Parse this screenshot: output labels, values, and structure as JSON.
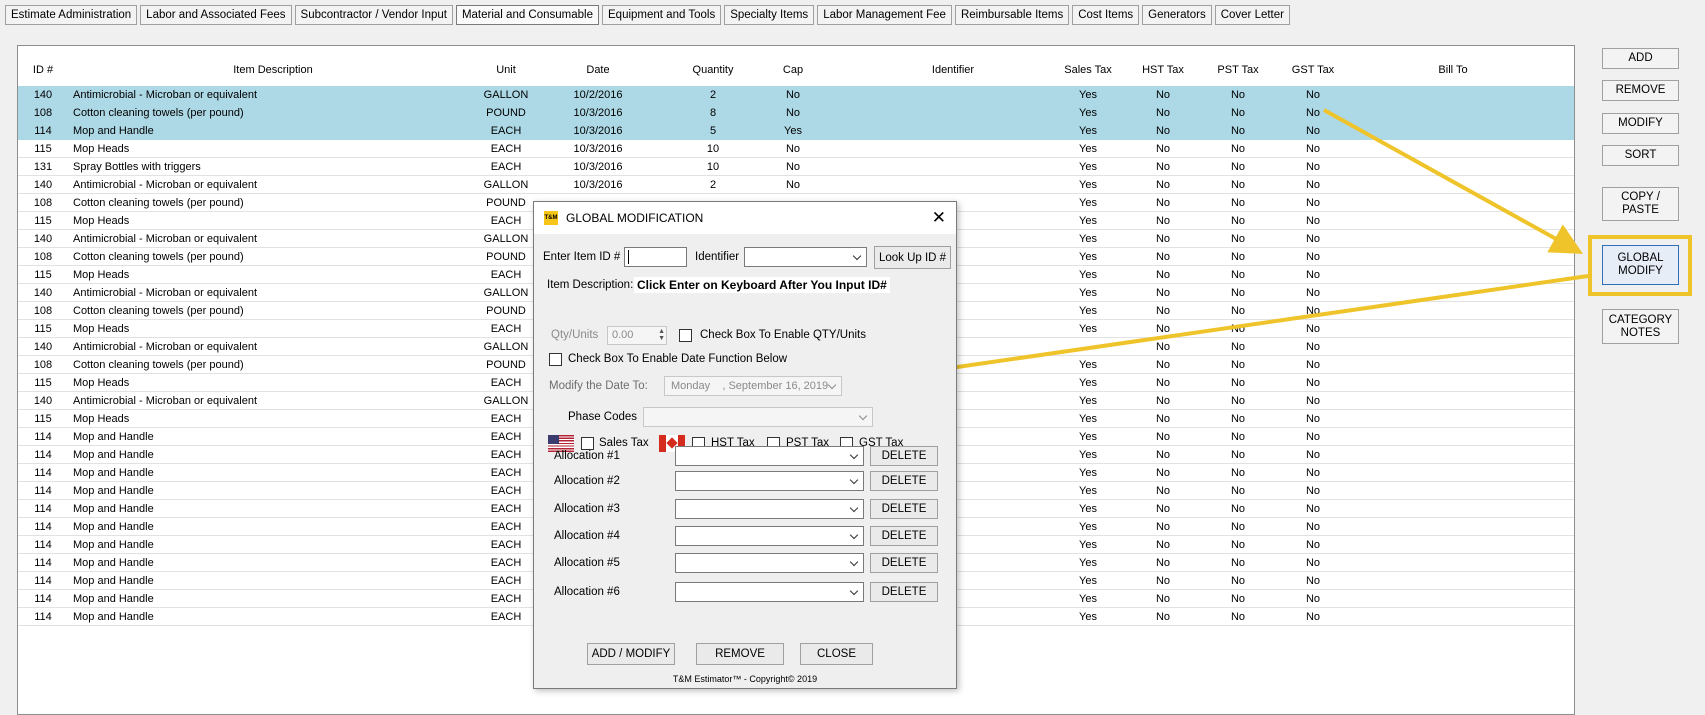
{
  "tabs": [
    "Estimate Administration",
    "Labor and Associated Fees",
    "Subcontractor / Vendor Input",
    "Material and Consumable",
    "Equipment and Tools",
    "Specialty Items",
    "Labor Management Fee",
    "Reimbursable Items",
    "Cost Items",
    "Generators",
    "Cover Letter"
  ],
  "active_tab_index": 3,
  "grid": {
    "headers": [
      "ID #",
      "Item Description",
      "Unit",
      "Date",
      "Quantity",
      "Cap",
      "Identifier",
      "Sales Tax",
      "HST Tax",
      "PST Tax",
      "GST Tax",
      "Bill To"
    ],
    "rows": [
      {
        "id": "140",
        "desc": "Antimicrobial - Microban or equivalent",
        "unit": "GALLON",
        "date": "10/2/2016",
        "qty": "2",
        "cap": "No",
        "ident": "",
        "sales": "Yes",
        "hst": "No",
        "pst": "No",
        "gst": "No",
        "bill": "",
        "selected": true
      },
      {
        "id": "108",
        "desc": "Cotton cleaning towels (per pound)",
        "unit": "POUND",
        "date": "10/3/2016",
        "qty": "8",
        "cap": "No",
        "ident": "",
        "sales": "Yes",
        "hst": "No",
        "pst": "No",
        "gst": "No",
        "bill": "",
        "selected": true
      },
      {
        "id": "114",
        "desc": "Mop  and Handle",
        "unit": "EACH",
        "date": "10/3/2016",
        "qty": "5",
        "cap": "Yes",
        "ident": "",
        "sales": "Yes",
        "hst": "No",
        "pst": "No",
        "gst": "No",
        "bill": "",
        "selected": true
      },
      {
        "id": "115",
        "desc": "Mop Heads",
        "unit": "EACH",
        "date": "10/3/2016",
        "qty": "10",
        "cap": "No",
        "ident": "",
        "sales": "Yes",
        "hst": "No",
        "pst": "No",
        "gst": "No",
        "bill": ""
      },
      {
        "id": "131",
        "desc": "Spray Bottles with triggers",
        "unit": "EACH",
        "date": "10/3/2016",
        "qty": "10",
        "cap": "No",
        "ident": "",
        "sales": "Yes",
        "hst": "No",
        "pst": "No",
        "gst": "No",
        "bill": ""
      },
      {
        "id": "140",
        "desc": "Antimicrobial - Microban or equivalent",
        "unit": "GALLON",
        "date": "10/3/2016",
        "qty": "2",
        "cap": "No",
        "ident": "",
        "sales": "Yes",
        "hst": "No",
        "pst": "No",
        "gst": "No",
        "bill": ""
      },
      {
        "id": "108",
        "desc": "Cotton cleaning towels (per pound)",
        "unit": "POUND",
        "date": "",
        "qty": "",
        "cap": "",
        "ident": "",
        "sales": "Yes",
        "hst": "No",
        "pst": "No",
        "gst": "No",
        "bill": ""
      },
      {
        "id": "115",
        "desc": "Mop Heads",
        "unit": "EACH",
        "date": "",
        "qty": "",
        "cap": "",
        "ident": "",
        "sales": "Yes",
        "hst": "No",
        "pst": "No",
        "gst": "No",
        "bill": ""
      },
      {
        "id": "140",
        "desc": "Antimicrobial - Microban or equivalent",
        "unit": "GALLON",
        "date": "",
        "qty": "",
        "cap": "",
        "ident": "",
        "sales": "Yes",
        "hst": "No",
        "pst": "No",
        "gst": "No",
        "bill": ""
      },
      {
        "id": "108",
        "desc": "Cotton cleaning towels (per pound)",
        "unit": "POUND",
        "date": "",
        "qty": "",
        "cap": "",
        "ident": "",
        "sales": "Yes",
        "hst": "No",
        "pst": "No",
        "gst": "No",
        "bill": ""
      },
      {
        "id": "115",
        "desc": "Mop Heads",
        "unit": "EACH",
        "date": "",
        "qty": "",
        "cap": "",
        "ident": "",
        "sales": "Yes",
        "hst": "No",
        "pst": "No",
        "gst": "No",
        "bill": ""
      },
      {
        "id": "140",
        "desc": "Antimicrobial - Microban or equivalent",
        "unit": "GALLON",
        "date": "",
        "qty": "",
        "cap": "",
        "ident": "",
        "sales": "Yes",
        "hst": "No",
        "pst": "No",
        "gst": "No",
        "bill": ""
      },
      {
        "id": "108",
        "desc": "Cotton cleaning towels (per pound)",
        "unit": "POUND",
        "date": "",
        "qty": "",
        "cap": "",
        "ident": "",
        "sales": "Yes",
        "hst": "No",
        "pst": "No",
        "gst": "No",
        "bill": ""
      },
      {
        "id": "115",
        "desc": "Mop Heads",
        "unit": "EACH",
        "date": "",
        "qty": "",
        "cap": "",
        "ident": "",
        "sales": "Yes",
        "hst": "No",
        "pst": "No",
        "gst": "No",
        "bill": ""
      },
      {
        "id": "140",
        "desc": "Antimicrobial - Microban or equivalent",
        "unit": "GALLON",
        "date": "",
        "qty": "",
        "cap": "",
        "ident": "",
        "sales": "",
        "hst": "No",
        "pst": "No",
        "gst": "No",
        "bill": ""
      },
      {
        "id": "108",
        "desc": "Cotton cleaning towels (per pound)",
        "unit": "POUND",
        "date": "",
        "qty": "",
        "cap": "",
        "ident": "",
        "sales": "Yes",
        "hst": "No",
        "pst": "No",
        "gst": "No",
        "bill": ""
      },
      {
        "id": "115",
        "desc": "Mop Heads",
        "unit": "EACH",
        "date": "",
        "qty": "",
        "cap": "",
        "ident": "",
        "sales": "Yes",
        "hst": "No",
        "pst": "No",
        "gst": "No",
        "bill": ""
      },
      {
        "id": "140",
        "desc": "Antimicrobial - Microban or equivalent",
        "unit": "GALLON",
        "date": "",
        "qty": "",
        "cap": "",
        "ident": "",
        "sales": "Yes",
        "hst": "No",
        "pst": "No",
        "gst": "No",
        "bill": ""
      },
      {
        "id": "115",
        "desc": "Mop Heads",
        "unit": "EACH",
        "date": "",
        "qty": "",
        "cap": "",
        "ident": "",
        "sales": "Yes",
        "hst": "No",
        "pst": "No",
        "gst": "No",
        "bill": ""
      },
      {
        "id": "114",
        "desc": "Mop  and Handle",
        "unit": "EACH",
        "date": "",
        "qty": "",
        "cap": "",
        "ident": "",
        "sales": "Yes",
        "hst": "No",
        "pst": "No",
        "gst": "No",
        "bill": ""
      },
      {
        "id": "114",
        "desc": "Mop  and Handle",
        "unit": "EACH",
        "date": "",
        "qty": "",
        "cap": "",
        "ident": "",
        "sales": "Yes",
        "hst": "No",
        "pst": "No",
        "gst": "No",
        "bill": ""
      },
      {
        "id": "114",
        "desc": "Mop  and Handle",
        "unit": "EACH",
        "date": "",
        "qty": "",
        "cap": "",
        "ident": "",
        "sales": "Yes",
        "hst": "No",
        "pst": "No",
        "gst": "No",
        "bill": ""
      },
      {
        "id": "114",
        "desc": "Mop  and Handle",
        "unit": "EACH",
        "date": "",
        "qty": "",
        "cap": "",
        "ident": "",
        "sales": "Yes",
        "hst": "No",
        "pst": "No",
        "gst": "No",
        "bill": ""
      },
      {
        "id": "114",
        "desc": "Mop  and Handle",
        "unit": "EACH",
        "date": "",
        "qty": "",
        "cap": "",
        "ident": "",
        "sales": "Yes",
        "hst": "No",
        "pst": "No",
        "gst": "No",
        "bill": ""
      },
      {
        "id": "114",
        "desc": "Mop  and Handle",
        "unit": "EACH",
        "date": "",
        "qty": "",
        "cap": "",
        "ident": "",
        "sales": "Yes",
        "hst": "No",
        "pst": "No",
        "gst": "No",
        "bill": ""
      },
      {
        "id": "114",
        "desc": "Mop  and Handle",
        "unit": "EACH",
        "date": "",
        "qty": "",
        "cap": "",
        "ident": "",
        "sales": "Yes",
        "hst": "No",
        "pst": "No",
        "gst": "No",
        "bill": ""
      },
      {
        "id": "114",
        "desc": "Mop  and Handle",
        "unit": "EACH",
        "date": "",
        "qty": "",
        "cap": "",
        "ident": "",
        "sales": "Yes",
        "hst": "No",
        "pst": "No",
        "gst": "No",
        "bill": ""
      },
      {
        "id": "114",
        "desc": "Mop  and Handle",
        "unit": "EACH",
        "date": "",
        "qty": "",
        "cap": "",
        "ident": "",
        "sales": "Yes",
        "hst": "No",
        "pst": "No",
        "gst": "No",
        "bill": ""
      },
      {
        "id": "114",
        "desc": "Mop  and Handle",
        "unit": "EACH",
        "date": "",
        "qty": "",
        "cap": "",
        "ident": "",
        "sales": "Yes",
        "hst": "No",
        "pst": "No",
        "gst": "No",
        "bill": ""
      },
      {
        "id": "114",
        "desc": "Mop  and Handle",
        "unit": "EACH",
        "date": "",
        "qty": "",
        "cap": "",
        "ident": "",
        "sales": "Yes",
        "hst": "No",
        "pst": "No",
        "gst": "No",
        "bill": ""
      }
    ]
  },
  "side_buttons": [
    "ADD",
    "REMOVE",
    "MODIFY",
    "SORT",
    "COPY /\nPASTE",
    "GLOBAL\nMODIFY",
    "CATEGORY\nNOTES"
  ],
  "dialog": {
    "logo": "T&M",
    "title": "GLOBAL MODIFICATION",
    "close_glyph": "✕",
    "item_id_label": "Enter Item ID #",
    "item_id_value": "",
    "identifier_label": "Identifier",
    "identifier_value": "",
    "lookup_button": "Look Up ID #",
    "desc_label": "Item Description:",
    "desc_hint": "Click Enter on Keyboard After You Input ID#",
    "qty_label": "Qty/Units",
    "qty_value": "0.00",
    "qty_checkbox_label": "Check Box To Enable QTY/Units",
    "date_checkbox_label": "Check Box To Enable Date Function Below",
    "modify_date_label": "Modify the Date To:",
    "date_value": "Monday    , September 16, 2019",
    "phase_codes_label": "Phase Codes",
    "phase_codes_value": "",
    "tax": {
      "sales": "Sales Tax",
      "hst": "HST Tax",
      "pst": "PST Tax",
      "gst": "GST Tax"
    },
    "allocations": [
      {
        "label": "Allocation #1",
        "value": "",
        "delete": "DELETE"
      },
      {
        "label": "Allocation #2",
        "value": "",
        "delete": "DELETE"
      },
      {
        "label": "Allocation #3",
        "value": "",
        "delete": "DELETE"
      },
      {
        "label": "Allocation #4",
        "value": "",
        "delete": "DELETE"
      },
      {
        "label": "Allocation #5",
        "value": "",
        "delete": "DELETE"
      },
      {
        "label": "Allocation #6",
        "value": "",
        "delete": "DELETE"
      }
    ],
    "buttons": {
      "add_modify": "ADD / MODIFY",
      "remove": "REMOVE",
      "close": "CLOSE"
    },
    "footer": "T&M Estimator™ - Copyright© 2019"
  },
  "colors": {
    "selected_row": "#add8e6",
    "annotation": "#efc42b",
    "global_modify_border": "#2d6fb8"
  },
  "icons": {
    "us_flag": "us-flag-icon",
    "canada_flag": "canada-flag-icon",
    "close": "close-icon",
    "dropdown": "chevron-down-icon"
  }
}
